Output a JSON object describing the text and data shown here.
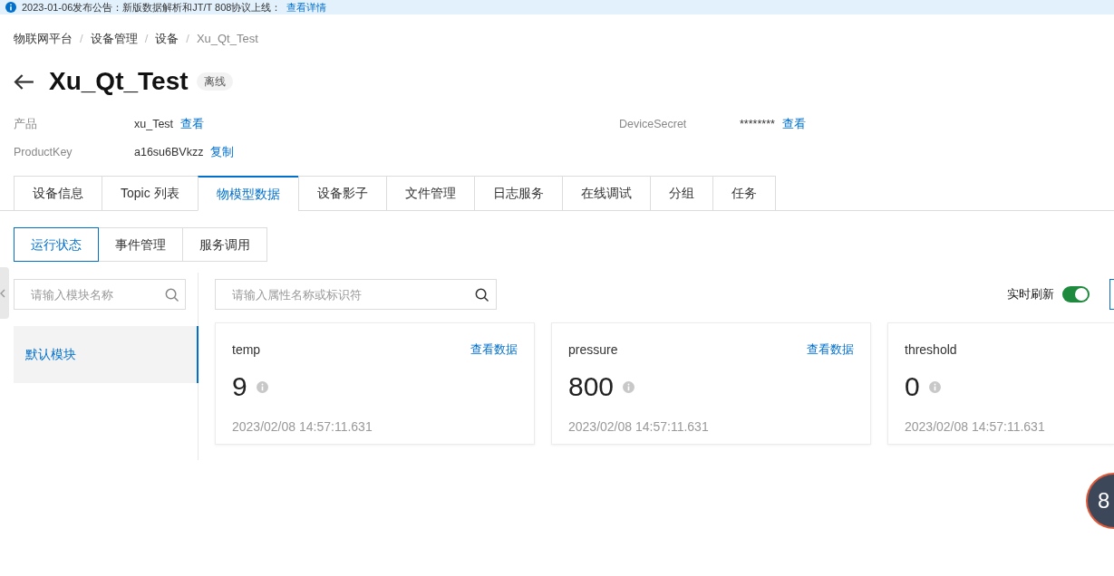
{
  "announcement": {
    "text": "2023-01-06发布公告：新版数据解析和JT/T 808协议上线：",
    "link": "查看详情"
  },
  "breadcrumb": {
    "items": [
      {
        "label": "物联网平台",
        "current": false
      },
      {
        "label": "设备管理",
        "current": false
      },
      {
        "label": "设备",
        "current": false
      },
      {
        "label": "Xu_Qt_Test",
        "current": true
      }
    ],
    "separators": [
      "/",
      "/",
      "/"
    ]
  },
  "device": {
    "name": "Xu_Qt_Test",
    "status": "离线"
  },
  "details": [
    {
      "label": "产品",
      "value": "xu_Test",
      "action": "查看"
    },
    {
      "label": "DeviceSecret",
      "value": "********",
      "action": "查看"
    },
    {
      "label": "ProductKey",
      "value": "a16su6BVkzz",
      "action": "复制"
    }
  ],
  "tabs": [
    {
      "label": "设备信息",
      "selected": false
    },
    {
      "label": "Topic 列表",
      "selected": false
    },
    {
      "label": "物模型数据",
      "selected": true
    },
    {
      "label": "设备影子",
      "selected": false
    },
    {
      "label": "文件管理",
      "selected": false
    },
    {
      "label": "日志服务",
      "selected": false
    },
    {
      "label": "在线调试",
      "selected": false
    },
    {
      "label": "分组",
      "selected": false
    },
    {
      "label": "任务",
      "selected": false
    }
  ],
  "subtabs": [
    {
      "label": "运行状态",
      "selected": true
    },
    {
      "label": "事件管理",
      "selected": false
    },
    {
      "label": "服务调用",
      "selected": false
    }
  ],
  "module_panel": {
    "search": {
      "placeholder": "请输入模块名称"
    },
    "modules": [
      {
        "label": "默认模块",
        "selected": true
      }
    ]
  },
  "property_search": {
    "placeholder": "请输入属性名称或标识符"
  },
  "realtime_refresh": {
    "label": "实时刷新",
    "on": true
  },
  "properties": [
    {
      "name": "temp",
      "link": "查看数据",
      "value": "9",
      "time": "2023/02/08 14:57:11.631"
    },
    {
      "name": "pressure",
      "link": "查看数据",
      "value": "800",
      "time": "2023/02/08 14:57:11.631"
    },
    {
      "name": "threshold",
      "value": "0",
      "time": "2023/02/08 14:57:11.631"
    }
  ],
  "speed_widget": {
    "reading": "8"
  }
}
